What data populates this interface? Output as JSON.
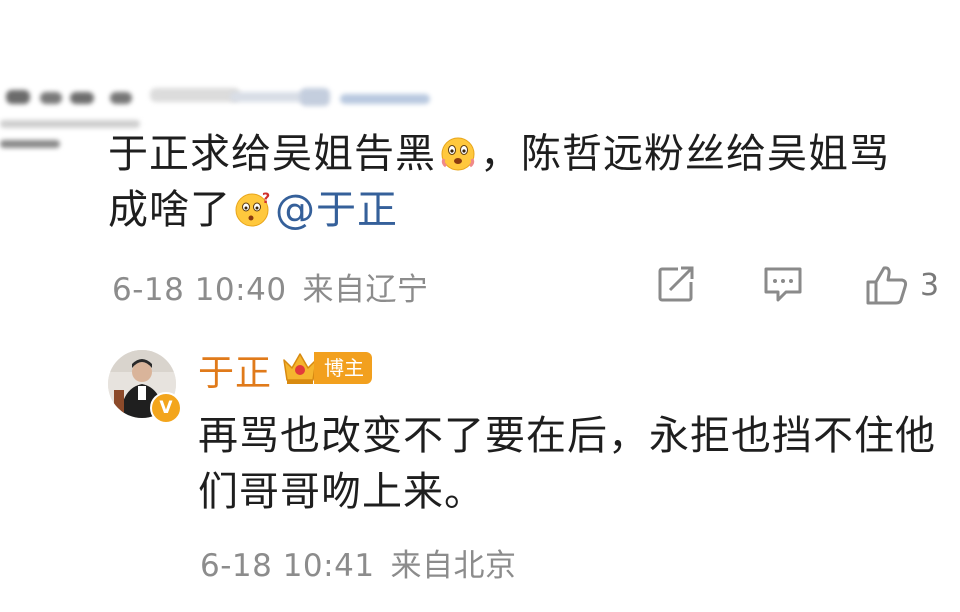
{
  "comment": {
    "text_part1": "于正求给吴姐告黑",
    "emoji1": "scared-face-emoji",
    "text_part2": "，陈哲远粉丝给吴姐骂成啥了",
    "emoji2": "confused-face-emoji",
    "mention": "@于正",
    "time": "6-18 10:40",
    "location": "来自辽宁",
    "like_count": "3"
  },
  "reply": {
    "author": "于正",
    "badge_label": "博主",
    "verified_mark": "V",
    "text": "再骂也改变不了要在后，永拒也挡不住他们哥哥吻上来。",
    "time": "6-18 10:41",
    "location": "来自北京"
  },
  "icons": {
    "share": "share-icon",
    "comment": "comment-icon",
    "like": "thumbs-up-icon"
  },
  "colors": {
    "mention": "#35609a",
    "author_name": "#e07a1a",
    "badge": "#f2a01e",
    "meta": "#8c8c8c"
  }
}
